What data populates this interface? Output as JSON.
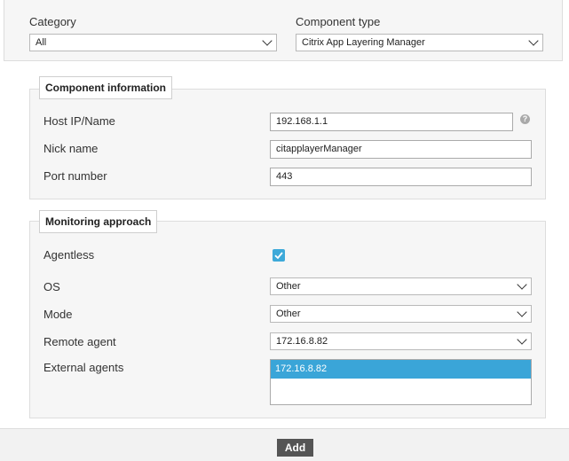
{
  "header": {
    "category_label": "Category",
    "category_value": "All",
    "component_type_label": "Component type",
    "component_type_value": "Citrix App Layering Manager"
  },
  "component_information": {
    "title": "Component information",
    "host_label": "Host IP/Name",
    "host_value": "192.168.1.1",
    "help_glyph": "?",
    "nick_label": "Nick name",
    "nick_value": "citapplayerManager",
    "port_label": "Port number",
    "port_value": "443"
  },
  "monitoring_approach": {
    "title": "Monitoring approach",
    "agentless_label": "Agentless",
    "agentless_checked": true,
    "os_label": "OS",
    "os_value": "Other",
    "mode_label": "Mode",
    "mode_value": "Other",
    "remote_agent_label": "Remote agent",
    "remote_agent_value": "172.16.8.82",
    "external_agents_label": "External agents",
    "external_agents": [
      "172.16.8.82"
    ]
  },
  "footer": {
    "add_label": "Add"
  },
  "colors": {
    "accent": "#3aa5d8",
    "button": "#555555"
  }
}
